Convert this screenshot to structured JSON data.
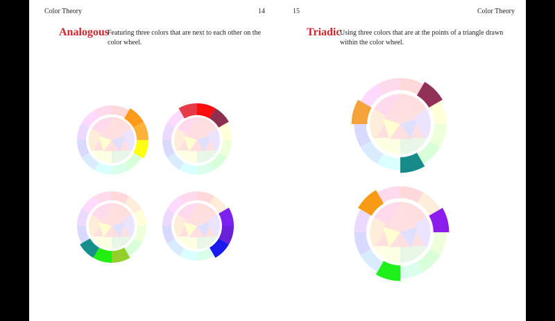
{
  "left_page": {
    "running_title": "Color Theory",
    "page_number": "14",
    "heading": "Analogous",
    "description": "Featuring three colors that are next to each other on the color wheel."
  },
  "right_page": {
    "running_title": "Color Theory",
    "page_number": "15",
    "heading": "Triadic",
    "description": "Using three colors that are at the points of a triangle drawn within the color wheel."
  },
  "colors": {
    "heading_red": "#d0262e",
    "wheel_segments": [
      "#ff0000",
      "#ff8000",
      "#ffff00",
      "#80ff00",
      "#00ff00",
      "#00ff80",
      "#00ffff",
      "#0080ff",
      "#0000ff",
      "#8000ff",
      "#ff00ff",
      "#ff0080"
    ]
  },
  "figures": {
    "analogous_examples": [
      {
        "highlighted": [
          {
            "s": 1,
            "c": "#ff9a1a"
          },
          {
            "s": 2,
            "c": "#ffb23a"
          },
          {
            "s": 3,
            "c": "#ffff10"
          }
        ]
      },
      {
        "highlighted": [
          {
            "s": 11,
            "c": "#e63a46"
          },
          {
            "s": 0,
            "c": "#ff0d0d"
          },
          {
            "s": 1,
            "c": "#8d3050"
          }
        ]
      },
      {
        "highlighted": [
          {
            "s": 5,
            "c": "#92cf2a"
          },
          {
            "s": 6,
            "c": "#22ee10"
          },
          {
            "s": 7,
            "c": "#17908c"
          }
        ]
      },
      {
        "highlighted": [
          {
            "s": 2,
            "c": "#7c22ee"
          },
          {
            "s": 3,
            "c": "#6a20d8"
          },
          {
            "s": 4,
            "c": "#1a1aee"
          }
        ]
      }
    ],
    "triadic_examples": [
      {
        "highlighted": [
          {
            "s": 1,
            "c": "#933058"
          },
          {
            "s": 5,
            "c": "#178a8a"
          },
          {
            "s": 9,
            "c": "#f5a23a"
          }
        ]
      },
      {
        "highlighted": [
          {
            "s": 2,
            "c": "#8b1ced"
          },
          {
            "s": 6,
            "c": "#1ff01c"
          },
          {
            "s": 10,
            "c": "#f99a14"
          }
        ]
      }
    ]
  }
}
